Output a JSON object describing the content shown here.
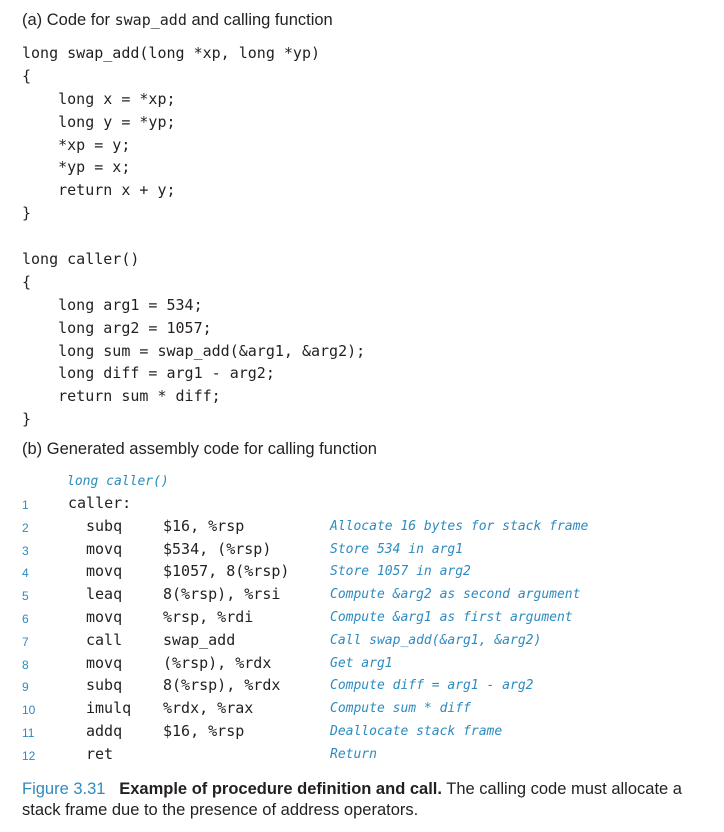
{
  "section_a": {
    "label": "(a) Code for ",
    "label_code": "swap_add",
    "label_tail": " and calling function"
  },
  "code_a": [
    "long swap_add(long *xp, long *yp)",
    "{",
    "    long x = *xp;",
    "    long y = *yp;",
    "    *xp = y;",
    "    *yp = x;",
    "    return x + y;",
    "}",
    "",
    "long caller()",
    "{",
    "    long arg1 = 534;",
    "    long arg2 = 1057;",
    "    long sum = swap_add(&arg1, &arg2);",
    "    long diff = arg1 - arg2;",
    "    return sum * diff;",
    "}"
  ],
  "section_b": {
    "label": "(b) Generated assembly code for calling function"
  },
  "asm_header": "long caller()",
  "asm": [
    {
      "num": "1",
      "label": "caller:",
      "op": "",
      "args": "",
      "comment": ""
    },
    {
      "num": "2",
      "label": "",
      "op": "subq",
      "args": "$16, %rsp",
      "comment": "Allocate 16 bytes for stack frame"
    },
    {
      "num": "3",
      "label": "",
      "op": "movq",
      "args": "$534, (%rsp)",
      "comment": "Store 534 in arg1"
    },
    {
      "num": "4",
      "label": "",
      "op": "movq",
      "args": "$1057, 8(%rsp)",
      "comment": "Store 1057 in arg2"
    },
    {
      "num": "5",
      "label": "",
      "op": "leaq",
      "args": "8(%rsp), %rsi",
      "comment": "Compute &arg2 as second argument"
    },
    {
      "num": "6",
      "label": "",
      "op": "movq",
      "args": "%rsp, %rdi",
      "comment": "Compute &arg1 as first argument"
    },
    {
      "num": "7",
      "label": "",
      "op": "call",
      "args": "swap_add",
      "comment": "Call swap_add(&arg1, &arg2)"
    },
    {
      "num": "8",
      "label": "",
      "op": "movq",
      "args": "(%rsp), %rdx",
      "comment": "Get arg1"
    },
    {
      "num": "9",
      "label": "",
      "op": "subq",
      "args": "8(%rsp), %rdx",
      "comment": "Compute diff = arg1 - arg2"
    },
    {
      "num": "10",
      "label": "",
      "op": "imulq",
      "args": "%rdx, %rax",
      "comment": "Compute sum * diff"
    },
    {
      "num": "11",
      "label": "",
      "op": "addq",
      "args": "$16, %rsp",
      "comment": "Deallocate stack frame"
    },
    {
      "num": "12",
      "label": "",
      "op": "ret",
      "args": "",
      "comment": "Return"
    }
  ],
  "caption": {
    "figure": "Figure 3.31",
    "title": "Example of procedure definition and call.",
    "text": " The calling code must allocate a stack frame due to the presence of address operators."
  }
}
